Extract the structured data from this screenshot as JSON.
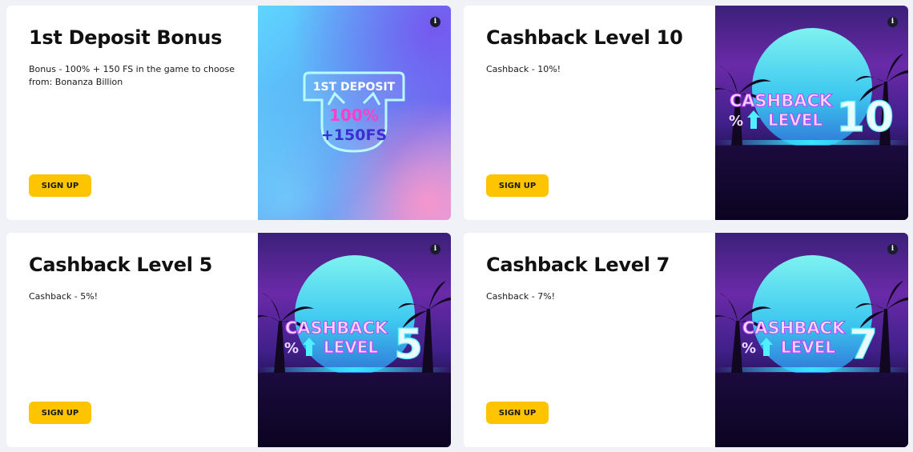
{
  "cards": [
    {
      "title": "1st Deposit Bonus",
      "description": "Bonus - 100% + 150 FS in the game to choose from: Bonanza Billion",
      "button_label": "SIGN UP",
      "image": {
        "type": "deposit",
        "line1": "1ST DEPOSIT",
        "line2": "100%",
        "line3": "+150FS"
      }
    },
    {
      "title": "Cashback Level 10",
      "description": "Cashback - 10%!",
      "button_label": "SIGN UP",
      "image": {
        "type": "cashback",
        "word1": "CASHBACK",
        "word2": "LEVEL",
        "percent": "%",
        "level": "10"
      }
    },
    {
      "title": "Cashback Level 5",
      "description": "Cashback - 5%!",
      "button_label": "SIGN UP",
      "image": {
        "type": "cashback",
        "word1": "CASHBACK",
        "word2": "LEVEL",
        "percent": "%",
        "level": "5"
      }
    },
    {
      "title": "Cashback Level 7",
      "description": "Cashback - 7%!",
      "button_label": "SIGN UP",
      "image": {
        "type": "cashback",
        "word1": "CASHBACK",
        "word2": "LEVEL",
        "percent": "%",
        "level": "7"
      }
    }
  ],
  "info_icon_glyph": "i",
  "colors": {
    "page_background": "#f1f1f8",
    "button_yellow": "#ffc400",
    "title_text": "#111111"
  }
}
